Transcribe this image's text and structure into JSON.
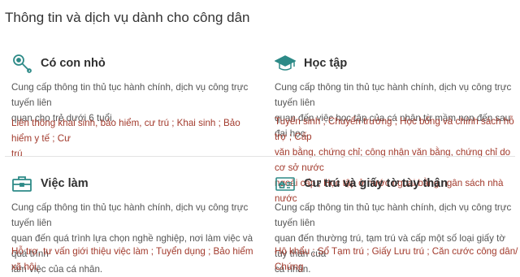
{
  "page": {
    "title": "Thông tin và dịch vụ dành cho công dân"
  },
  "colors": {
    "icon": "#2d8a87",
    "link": "#a23a2c",
    "text": "#555555"
  },
  "cards": [
    {
      "icon": "baby-rattle-icon",
      "title": "Có con nhỏ",
      "desc_lines": [
        "Cung cấp thông tin thủ tục hành chính, dịch vụ công trực tuyến liên",
        "quan cho trẻ dưới 6 tuổi."
      ],
      "link_lines": [
        "Liên thông khai sinh, bảo hiểm, cư trú ; Khai sinh ; Bảo hiểm y tế ; Cư",
        "trú"
      ]
    },
    {
      "icon": "graduation-cap-icon",
      "title": "Học tập",
      "desc_lines": [
        "Cung cấp thông tin thủ tục hành chính, dịch vụ công trực tuyến liên",
        "quan đến việc học tập của cá nhân từ mầm non đến sau đại học."
      ],
      "link_lines": [
        "Tuyển sinh ; Chuyển trường ; Học bổng và chính sách hỗ trợ ; Cấp",
        "văn bằng, chứng chỉ; công nhận văn bằng, chứng chỉ do cơ sở nước",
        "ngoài cấp ; Học tập ở nước ngoài bằng ngân sách nhà nước"
      ]
    },
    {
      "icon": "briefcase-icon",
      "title": "Việc làm",
      "desc_lines": [
        "Cung cấp thông tin thủ tục hành chính, dịch vụ công trực tuyến liên",
        "quan đến quá trình lựa chọn nghề nghiệp, nơi làm việc và quá trình",
        "làm việc của cá nhân."
      ],
      "link_lines": [
        "Hỗ trợ, tư vấn giới thiệu việc làm ; Tuyển dụng ; Bảo hiểm xã hội,"
      ]
    },
    {
      "icon": "id-card-house-icon",
      "title": "Cư trú và giấy tờ tùy thân",
      "desc_lines": [
        "Cung cấp thông tin thủ tục hành chính, dịch vụ công trực tuyến liên",
        "quan đến thường trú, tạm trú và cấp một số loại giấy tờ tùy thân của",
        "cá nhân."
      ],
      "link_lines": [
        "Hộ khẩu ; Sổ Tạm trú ; Giấy Lưu trú ; Căn cước công dân/ Chứng"
      ]
    }
  ]
}
